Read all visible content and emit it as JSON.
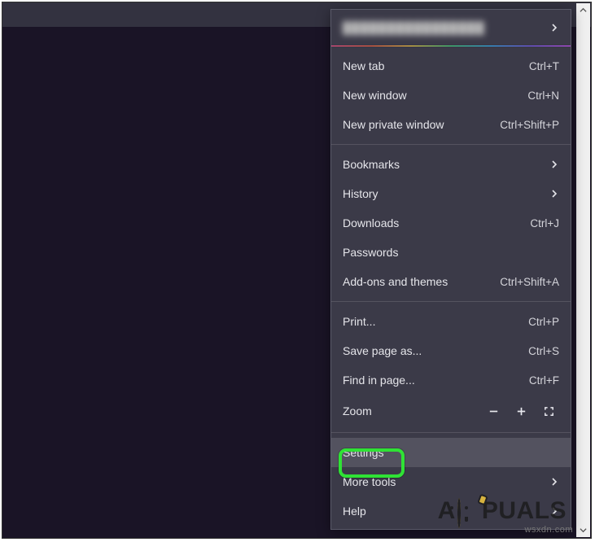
{
  "menu": {
    "account_label_obscured": "████████████████",
    "new_tab": {
      "label": "New tab",
      "shortcut": "Ctrl+T"
    },
    "new_window": {
      "label": "New window",
      "shortcut": "Ctrl+N"
    },
    "new_private_window": {
      "label": "New private window",
      "shortcut": "Ctrl+Shift+P"
    },
    "bookmarks": {
      "label": "Bookmarks"
    },
    "history": {
      "label": "History"
    },
    "downloads": {
      "label": "Downloads",
      "shortcut": "Ctrl+J"
    },
    "passwords": {
      "label": "Passwords"
    },
    "addons": {
      "label": "Add-ons and themes",
      "shortcut": "Ctrl+Shift+A"
    },
    "print": {
      "label": "Print...",
      "shortcut": "Ctrl+P"
    },
    "save_as": {
      "label": "Save page as...",
      "shortcut": "Ctrl+S"
    },
    "find": {
      "label": "Find in page...",
      "shortcut": "Ctrl+F"
    },
    "zoom": {
      "label": "Zoom"
    },
    "settings": {
      "label": "Settings"
    },
    "more_tools": {
      "label": "More tools"
    },
    "help": {
      "label": "Help"
    }
  },
  "watermark": {
    "prefix_letter": "A",
    "suffix_text": "PUALS",
    "site": "wsxdn.com"
  }
}
